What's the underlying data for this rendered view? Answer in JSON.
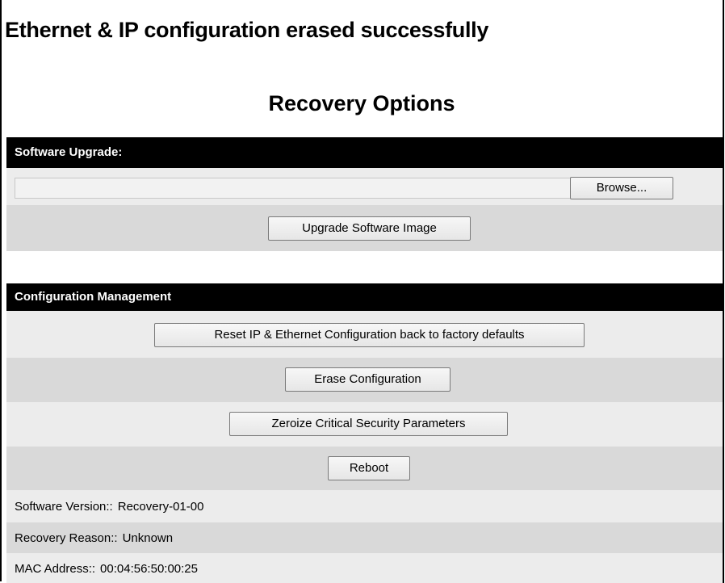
{
  "status_message": "Ethernet & IP configuration erased successfully",
  "page_title": "Recovery Options",
  "software_upgrade": {
    "header": "Software Upgrade:",
    "file_input_value": "",
    "browse_label": "Browse...",
    "upgrade_label": "Upgrade Software Image"
  },
  "config_management": {
    "header": "Configuration Management",
    "reset_label": "Reset IP & Ethernet Configuration back to factory defaults",
    "erase_label": "Erase Configuration",
    "zeroize_label": "Zeroize Critical Security Parameters",
    "reboot_label": "Reboot"
  },
  "info": {
    "software_version_label": "Software Version::",
    "software_version_value": "Recovery-01-00",
    "recovery_reason_label": "Recovery Reason::",
    "recovery_reason_value": "Unknown",
    "mac_address_label": "MAC Address::",
    "mac_address_value": "00:04:56:50:00:25"
  },
  "colors": {
    "header_bar": "#000000",
    "row_light": "#ececec",
    "row_dark": "#d9d9d9"
  }
}
